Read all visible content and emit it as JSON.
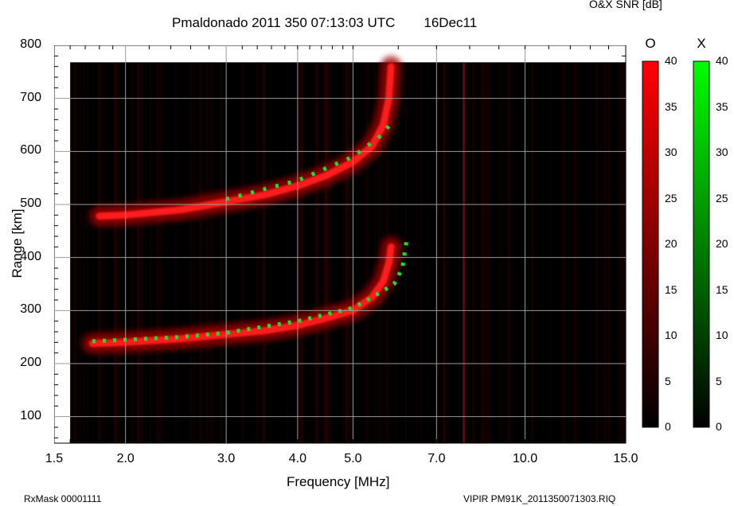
{
  "chart_data": {
    "type": "heatmap",
    "title": "Pmaldonado 2011 350 07:13:03 UTC",
    "date": "16Dec11",
    "xlabel": "Frequency [MHz]",
    "ylabel": "Range [km]",
    "x_scale": "log",
    "xlim": [
      1.5,
      15.0
    ],
    "ylim": [
      50,
      800
    ],
    "data_xlim": [
      1.6,
      15.0
    ],
    "data_ylim": [
      50,
      768
    ],
    "x_ticks": [
      1.5,
      2.0,
      3.0,
      4.0,
      5.0,
      7.0,
      10.0,
      15.0
    ],
    "x_tick_labels": [
      "1.5",
      "2.0",
      "3.0",
      "4.0",
      "5.0",
      "7.0",
      "10.0",
      "15.0"
    ],
    "y_ticks": [
      100,
      200,
      300,
      400,
      500,
      600,
      700,
      800
    ],
    "y_tick_labels": [
      "100",
      "200",
      "300",
      "400",
      "500",
      "600",
      "700",
      "800"
    ],
    "grid": true,
    "colorbar_title": "O&X SNR [dB]",
    "colorbars": [
      {
        "name": "O",
        "color": "#ff0000",
        "range": [
          0,
          40
        ],
        "ticks": [
          0,
          5,
          10,
          15,
          20,
          25,
          30,
          35,
          40
        ]
      },
      {
        "name": "X",
        "color": "#00ff00",
        "range": [
          0,
          40
        ],
        "ticks": [
          0,
          5,
          10,
          15,
          20,
          25,
          30,
          35,
          40
        ]
      }
    ],
    "traces": [
      {
        "mode": "O",
        "layer": "E-F1 lower trace",
        "points": [
          [
            1.75,
            238
          ],
          [
            2.0,
            240
          ],
          [
            2.5,
            247
          ],
          [
            3.0,
            255
          ],
          [
            3.5,
            262
          ],
          [
            4.0,
            272
          ],
          [
            4.5,
            286
          ],
          [
            5.0,
            300
          ],
          [
            5.4,
            325
          ],
          [
            5.65,
            355
          ],
          [
            5.78,
            390
          ],
          [
            5.83,
            420
          ]
        ]
      },
      {
        "mode": "O",
        "layer": "second hop upper trace",
        "points": [
          [
            1.8,
            478
          ],
          [
            2.0,
            480
          ],
          [
            2.5,
            490
          ],
          [
            3.0,
            505
          ],
          [
            3.5,
            518
          ],
          [
            4.0,
            535
          ],
          [
            4.5,
            555
          ],
          [
            5.0,
            580
          ],
          [
            5.4,
            610
          ],
          [
            5.65,
            650
          ],
          [
            5.78,
            700
          ],
          [
            5.83,
            760
          ]
        ]
      },
      {
        "mode": "X",
        "layer": "lower trace",
        "points": [
          [
            1.75,
            242
          ],
          [
            2.5,
            250
          ],
          [
            3.0,
            258
          ],
          [
            4.0,
            280
          ],
          [
            5.0,
            305
          ],
          [
            5.5,
            330
          ],
          [
            5.9,
            350
          ],
          [
            6.1,
            380
          ],
          [
            6.2,
            430
          ]
        ]
      },
      {
        "mode": "X",
        "layer": "upper trace",
        "points": [
          [
            3.0,
            510
          ],
          [
            4.0,
            545
          ],
          [
            5.0,
            590
          ],
          [
            5.6,
            630
          ],
          [
            5.9,
            660
          ]
        ]
      }
    ]
  },
  "snr_label": "O&X SNR [dB]",
  "footer_left": "RxMask 00001111",
  "footer_right": "VIPIR  PM91K_2011350071303.RIQ"
}
